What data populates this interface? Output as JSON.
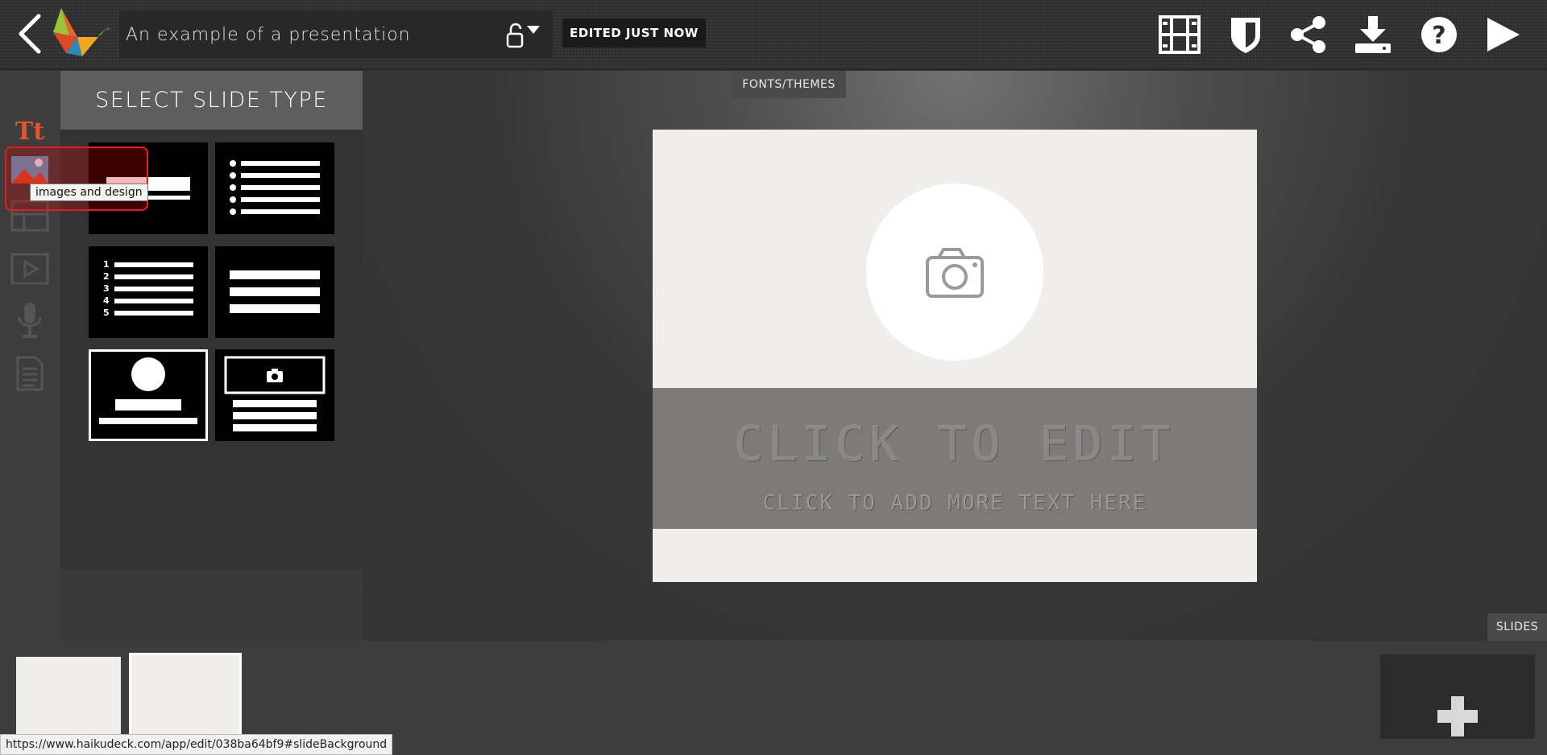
{
  "header": {
    "presentation_title": "An example of a presentation",
    "status_badge": "EDITED JUST NOW",
    "icons": [
      "back-arrow-icon",
      "haiku-deck-logo",
      "unlock-icon",
      "film-icon",
      "shield-icon",
      "share-icon",
      "download-icon",
      "help-icon",
      "play-icon"
    ]
  },
  "left_rail": {
    "icons": [
      "text-icon",
      "images-design-icon",
      "layout-icon",
      "video-icon",
      "microphone-icon",
      "notes-icon"
    ],
    "text_icon_glyph": "Tt",
    "active_color": "#e8542a"
  },
  "panel": {
    "header": "SELECT SLIDE TYPE",
    "slide_types": [
      "title",
      "bullet-list",
      "numbered-list",
      "text-lines",
      "profile",
      "photo-with-text"
    ],
    "numbered_list_numbers": [
      "1",
      "2",
      "3",
      "4",
      "5"
    ]
  },
  "tabs": {
    "fonts_themes": "FONTS/THEMES",
    "slides": "SLIDES"
  },
  "slide": {
    "title": "CLICK TO EDIT",
    "subtitle": "CLICK TO ADD MORE TEXT HERE",
    "photo_placeholder_icon": "camera-icon"
  },
  "tooltip": {
    "text": "images and design"
  },
  "status_url": "https://www.haikudeck.com/app/edit/038ba64bf9#slideBackground",
  "colors": {
    "accent": "#e8542a",
    "highlight": "#e02020",
    "slide_bg": "#f0eeea",
    "band": "#7c7b7a"
  }
}
